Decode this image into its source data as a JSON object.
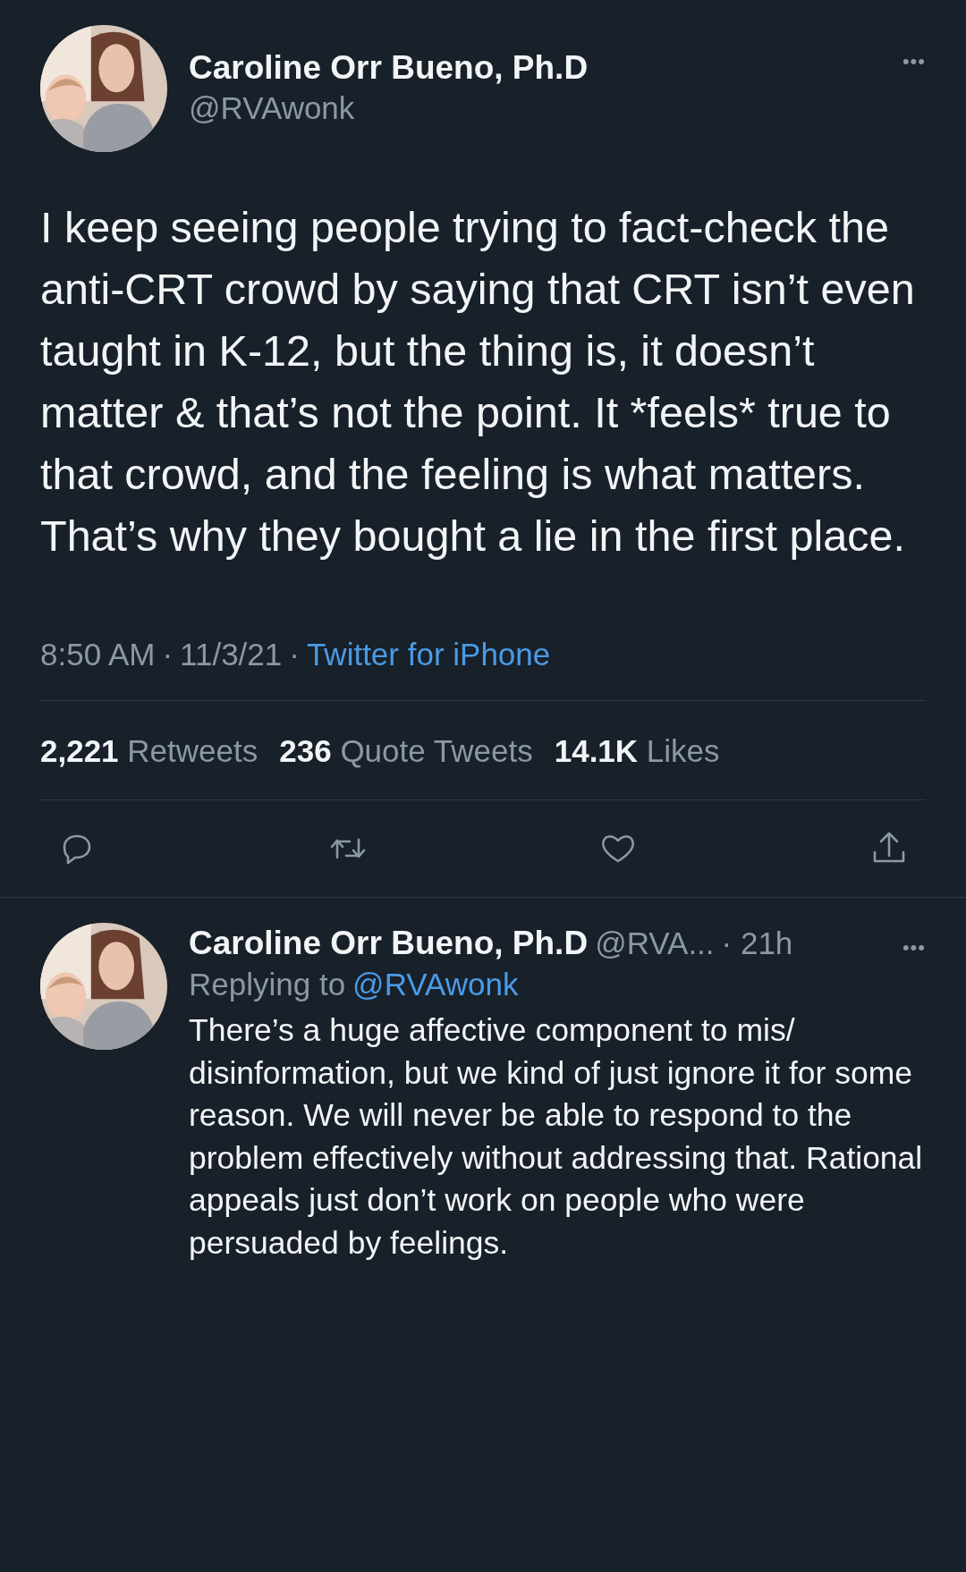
{
  "tweet": {
    "author": {
      "name": "Caroline Orr Bueno, Ph.D",
      "handle": "@RVAwonk"
    },
    "more": "•••",
    "text": "I keep seeing people trying to fact-check the anti-CRT crowd by saying that CRT isn’t even taught in K-12, but the thing is, it doesn’t matter & that’s not the point. It *feels* true to that crowd, and the feeling is what matters. That’s why they bought a lie in the first place.",
    "time": "8:50 AM",
    "separator": "·",
    "date": "11/3/21",
    "source": "Twitter for iPhone",
    "stats": [
      {
        "count": "2,221",
        "label": "Retweets"
      },
      {
        "count": "236",
        "label": "Quote Tweets"
      },
      {
        "count": "14.1K",
        "label": "Likes"
      }
    ],
    "actions": [
      {
        "kind": "reply"
      },
      {
        "kind": "retweet"
      },
      {
        "kind": "like"
      },
      {
        "kind": "share"
      }
    ]
  },
  "reply": {
    "author": {
      "name": "Caroline Orr Bueno, Ph.D",
      "handle": "@RVA..."
    },
    "age": "· 21h",
    "more": "•••",
    "replying_to": "Replying to",
    "replying_handle": "@RVAwonk",
    "text": "There’s a huge affective component to mis/ disinformation, but we kind of just ignore it for some reason. We will never be able to respond to the problem effectively without addressing that. Rational appeals just don’t work on people who were persuaded by feelings."
  }
}
